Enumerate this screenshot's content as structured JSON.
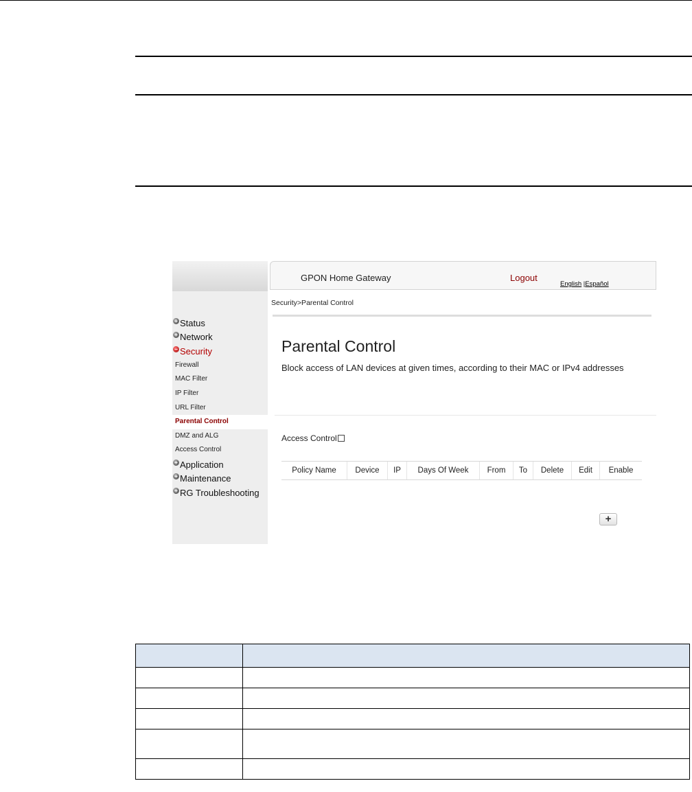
{
  "header": {
    "app_title": "GPON Home Gateway",
    "logout": "Logout",
    "lang_english": "English",
    "lang_sep": " |",
    "lang_spanish": "Español"
  },
  "breadcrumb": "Security>Parental Control",
  "sidebar": {
    "items": [
      {
        "label": "Status",
        "type": "top",
        "state": "collapsed"
      },
      {
        "label": "Network",
        "type": "top",
        "state": "collapsed"
      },
      {
        "label": "Security",
        "type": "top",
        "state": "expanded"
      },
      {
        "label": "Firewall",
        "type": "sub"
      },
      {
        "label": "MAC Filter",
        "type": "sub"
      },
      {
        "label": "IP Filter",
        "type": "sub"
      },
      {
        "label": "URL Filter",
        "type": "sub"
      },
      {
        "label": "Parental Control",
        "type": "sub",
        "selected": true
      },
      {
        "label": "DMZ and ALG",
        "type": "sub"
      },
      {
        "label": "Access Control",
        "type": "sub"
      },
      {
        "label": "Application",
        "type": "top",
        "state": "collapsed"
      },
      {
        "label": "Maintenance",
        "type": "top",
        "state": "collapsed"
      },
      {
        "label": "RG Troubleshooting",
        "type": "top",
        "state": "collapsed"
      }
    ]
  },
  "main": {
    "title": "Parental Control",
    "description": "Block access of LAN devices at given times, according to their MAC or IPv4 addresses",
    "access_control_label": "Access Control",
    "access_control_checked": false,
    "table_headers": [
      "Policy Name",
      "Device",
      "IP",
      "Days Of Week",
      "From",
      "To",
      "Delete",
      "Edit",
      "Enable"
    ],
    "add_button": "+"
  },
  "colors": {
    "accent": "#8b0000",
    "table_header_bg": "#dbe5f1",
    "sidebar_bg": "#eeeeee"
  }
}
